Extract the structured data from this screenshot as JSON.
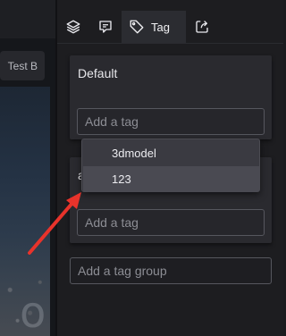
{
  "viewport": {
    "preset_tab": "Test B"
  },
  "toolbar": {
    "tag_tab_label": "Tag",
    "icons": [
      "layers-icon",
      "comment-icon",
      "tag-icon",
      "export-icon"
    ]
  },
  "groups": [
    {
      "title": "Default",
      "input_placeholder": "Add a tag"
    },
    {
      "title": "a",
      "input_placeholder": "Add a tag"
    }
  ],
  "add_group_placeholder": "Add a tag group",
  "dropdown": {
    "items": [
      "3dmodel",
      "123"
    ],
    "highlighted": "123"
  },
  "colors": {
    "annotation_arrow": "#e8332b",
    "active_tab_bg": "#2b2c31",
    "card_bg": "#2a2a2f"
  }
}
